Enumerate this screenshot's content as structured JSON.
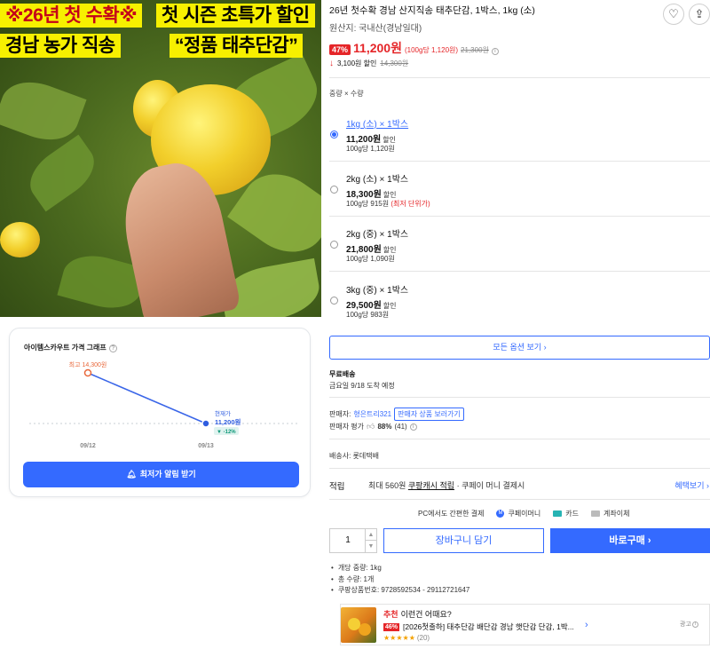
{
  "photo": {
    "banner1": "※26년 첫 수확※",
    "banner2": "첫 시즌 초특가 할인",
    "banner3": "경남 농가 직송",
    "banner4": "“정품 태추단감”"
  },
  "graph": {
    "title": "아이템스카우트 가격 그래프",
    "high_label": "최고 14,300원",
    "current_label": "현재가",
    "current_price": "11,200원",
    "current_change": "▼ -12%",
    "x_labels": [
      "09/12",
      "09/13"
    ],
    "alarm_button": "최저가 알림 받기"
  },
  "chart_data": {
    "type": "line",
    "x": [
      "09/12",
      "09/13"
    ],
    "series": [
      {
        "values": [
          14300,
          11200
        ]
      }
    ],
    "annotations": [
      "최고 14,300원",
      "현재가 11,200원",
      "▼ -12%"
    ]
  },
  "product": {
    "title": "26년 첫수확 경남 산지직송 태추단감, 1박스, 1kg (소)",
    "origin": "원산지: 국내산(경남일대)",
    "discount": "47%",
    "price": "11,200원",
    "unit_price": "(100g당 1,120원)",
    "orig_price": "21,300원",
    "saving": "3,100원 할인",
    "saving_orig": "14,300원"
  },
  "options": {
    "label": "중량 × 수량",
    "items": [
      {
        "name": "1kg (소) × 1박스",
        "price": "11,200원",
        "tag": "할인",
        "per": "100g당 1,120원",
        "best": "",
        "selected": true
      },
      {
        "name": "2kg (소) × 1박스",
        "price": "18,300원",
        "tag": "할인",
        "per": "100g당 915원",
        "best": "(최저 단위가)",
        "selected": false
      },
      {
        "name": "2kg (중) × 1박스",
        "price": "21,800원",
        "tag": "할인",
        "per": "100g당 1,090원",
        "best": "",
        "selected": false
      },
      {
        "name": "3kg (중) × 1박스",
        "price": "29,500원",
        "tag": "할인",
        "per": "100g당 983원",
        "best": "",
        "selected": false
      }
    ],
    "all_button": "모든 옵션 보기 ›"
  },
  "shipping": {
    "free": "무료배송",
    "date": "금요일 9/18 도착 예정",
    "seller_label": "판매자:",
    "seller_name": "형은트리321",
    "seller_button": "판매자 상품 보러가기",
    "rating_label": "판매자 평가",
    "rating_pct": "88%",
    "rating_count": "(41)",
    "carrier": "배송사: 롯데택배"
  },
  "reward": {
    "label": "적립",
    "text_pre": "최대 560원",
    "text_link": "쿠팡캐시 적립",
    "text_post": "· 쿠페이 머니 결제시",
    "link": "혜택보기 ›"
  },
  "payment": {
    "label": "PC에서도 간편한 결제",
    "m1_icon": "M",
    "m1": "쿠페이머니",
    "m2": "카드",
    "m3": "계좌이체"
  },
  "purchase": {
    "quantity": "1",
    "cart_button": "장바구니 담기",
    "buy_button": "바로구매 ›"
  },
  "specs": [
    "개당 중량: 1kg",
    "총 수량: 1개",
    "쿠팡상품번호: 9728592534 - 29112721647"
  ],
  "reco": {
    "prefix": "추천",
    "headline": "이런건 어때요?",
    "discount": "46%",
    "name": "[2026첫출하] 태추단감 배단감 경남 햇단감 단감, 1박...",
    "stars": "★★★★★",
    "reviews": "(20)",
    "ad": "광고"
  },
  "colors": {
    "accent": "#346aff",
    "sale": "#e52528",
    "banner": "#f7f000"
  }
}
